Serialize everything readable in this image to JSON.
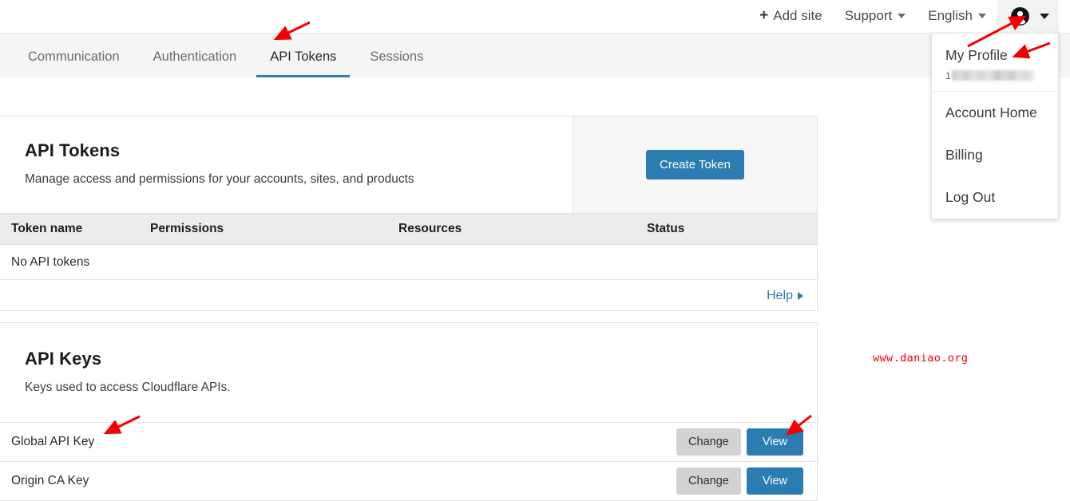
{
  "header": {
    "add_site_plus": "+",
    "add_site_label": "Add site",
    "support_label": "Support",
    "language_label": "English",
    "account_icon": "account-circle-icon"
  },
  "tabs": [
    {
      "label": "Communication",
      "active": false
    },
    {
      "label": "Authentication",
      "active": false
    },
    {
      "label": "API Tokens",
      "active": true
    },
    {
      "label": "Sessions",
      "active": false
    }
  ],
  "api_tokens_card": {
    "title": "API Tokens",
    "subtitle": "Manage access and permissions for your accounts, sites, and products",
    "create_button": "Create Token",
    "table": {
      "columns": [
        "Token name",
        "Permissions",
        "Resources",
        "Status"
      ],
      "empty_message": "No API tokens",
      "rows": []
    },
    "help_label": "Help"
  },
  "api_keys_card": {
    "title": "API Keys",
    "subtitle": "Keys used to access Cloudflare APIs.",
    "rows": [
      {
        "name": "Global API Key",
        "change_label": "Change",
        "view_label": "View"
      },
      {
        "name": "Origin CA Key",
        "change_label": "Change",
        "view_label": "View"
      }
    ]
  },
  "account_menu": {
    "profile_label": "My Profile",
    "email_prefix": "1",
    "email_redacted": true,
    "items": [
      {
        "label": "Account Home"
      },
      {
        "label": "Billing"
      },
      {
        "label": "Log Out"
      }
    ]
  },
  "watermark": {
    "text": "www.daniao.org"
  },
  "colors": {
    "accent_blue": "#2b7cb0",
    "tab_bar_bg": "#f5f5f5",
    "table_head_bg": "#ececec",
    "button_gray": "#d2d2d2",
    "annotation_red": "#f50000"
  }
}
